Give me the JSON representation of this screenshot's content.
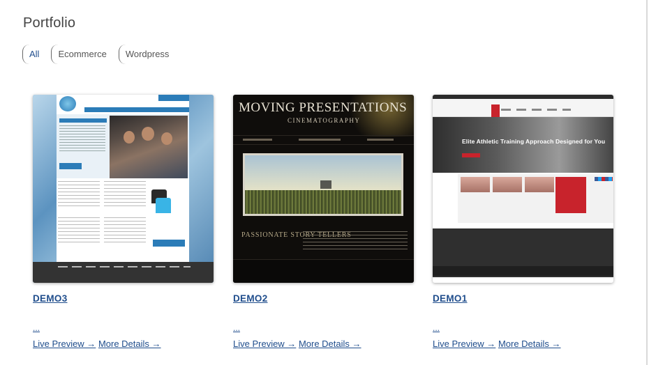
{
  "page": {
    "title": "Portfolio"
  },
  "filters": [
    {
      "label": "All",
      "active": true
    },
    {
      "label": "Ecommerce",
      "active": false
    },
    {
      "label": "Wordpress",
      "active": false
    }
  ],
  "cards": [
    {
      "title": "DEMO3",
      "excerpt": "...",
      "live_preview": "Live Preview →",
      "more_details": "More Details →"
    },
    {
      "title": "DEMO2",
      "excerpt": "...",
      "live_preview": "Live Preview →",
      "more_details": "More Details →",
      "thumb": {
        "brand": "MOVING PRESENTATIONS",
        "subbrand": "CINEMATOGRAPHY",
        "tagline": "PASSIONATE STORY TELLERS"
      }
    },
    {
      "title": "DEMO1",
      "excerpt": "...",
      "live_preview": "Live Preview →",
      "more_details": "More Details →",
      "thumb": {
        "hero": "Elite Athletic Training Approach Designed for You"
      }
    }
  ],
  "colors": {
    "link": "#1f4d8c",
    "title": "#444444",
    "accent_red": "#c8232c",
    "accent_blue": "#2b7cb8"
  }
}
